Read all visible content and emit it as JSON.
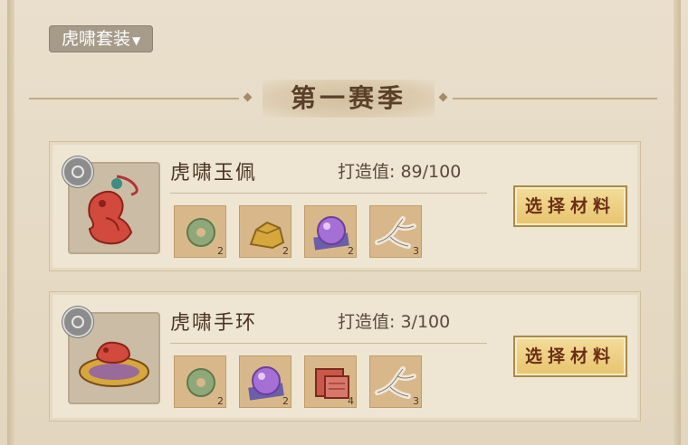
{
  "set_selector": {
    "label": "虎啸套装",
    "arrow": "▼"
  },
  "season": {
    "title": "第一赛季"
  },
  "items": [
    {
      "name": "虎啸玉佩",
      "forge_label": "打造值:",
      "forge_value": "89/100",
      "icon": "jade-pendant-icon",
      "materials": [
        {
          "icon": "jade-ring-icon",
          "qty": "2"
        },
        {
          "icon": "gold-ore-icon",
          "qty": "2"
        },
        {
          "icon": "purple-orb-icon",
          "qty": "2"
        },
        {
          "icon": "bone-branch-icon",
          "qty": "3"
        }
      ],
      "button": "选择材料"
    },
    {
      "name": "虎啸手环",
      "forge_label": "打造值:",
      "forge_value": "3/100",
      "icon": "bracelet-icon",
      "materials": [
        {
          "icon": "jade-ring-icon",
          "qty": "2"
        },
        {
          "icon": "purple-orb-icon",
          "qty": "2"
        },
        {
          "icon": "red-scroll-icon",
          "qty": "4"
        },
        {
          "icon": "bone-branch-icon",
          "qty": "3"
        }
      ],
      "button": "选择材料"
    }
  ]
}
